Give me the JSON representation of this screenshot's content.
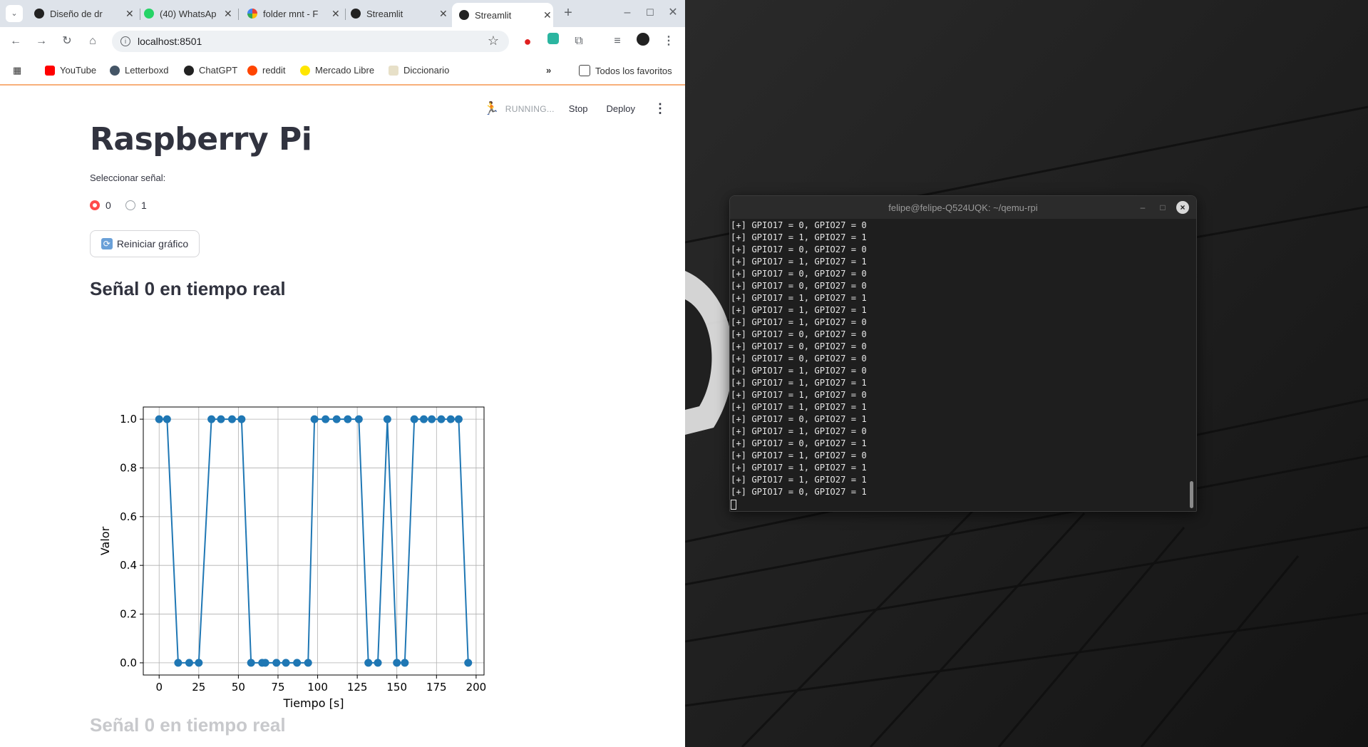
{
  "browser": {
    "tabs": [
      {
        "label": "Diseño de dr",
        "icon": "openai-icon"
      },
      {
        "label": "(40) WhatsAp",
        "icon": "whatsapp-icon"
      },
      {
        "label": "folder mnt - F",
        "icon": "google-icon"
      },
      {
        "label": "Streamlit",
        "icon": "streamlit-icon"
      },
      {
        "label": "Streamlit",
        "icon": "streamlit-icon"
      }
    ],
    "url": "localhost:8501",
    "bookmarks": [
      "YouTube",
      "Letterboxd",
      "ChatGPT",
      "reddit",
      "Mercado Libre",
      "Diccionario"
    ],
    "all_bookmarks": "Todos los favoritos"
  },
  "app": {
    "status": "RUNNING...",
    "stop": "Stop",
    "deploy": "Deploy",
    "title": "Raspberry Pi",
    "radio_label": "Seleccionar señal:",
    "radio_options": [
      "0",
      "1"
    ],
    "selected": "0",
    "reset_button": "Reiniciar gráfico",
    "subheader": "Señal 0 en tiempo real",
    "subheader_faded": "Señal 0 en tiempo real"
  },
  "chart_data": {
    "type": "line",
    "xlabel": "Tiempo [s]",
    "ylabel": "Valor",
    "xlim": [
      -10,
      205
    ],
    "ylim": [
      -0.05,
      1.05
    ],
    "xticks": [
      0,
      25,
      50,
      75,
      100,
      125,
      150,
      175,
      200
    ],
    "yticks": [
      0.0,
      0.2,
      0.4,
      0.6,
      0.8,
      1.0
    ],
    "grid": true,
    "color": "#1f77b4",
    "x": [
      0,
      5,
      12,
      19,
      25,
      33,
      39,
      46,
      52,
      58,
      65,
      67,
      74,
      80,
      87,
      94,
      98,
      105,
      112,
      119,
      126,
      132,
      138,
      144,
      150,
      155,
      161,
      167,
      172,
      178,
      184,
      189,
      195
    ],
    "y": [
      1,
      1,
      0,
      0,
      0,
      1,
      1,
      1,
      1,
      0,
      0,
      0,
      0,
      0,
      0,
      0,
      1,
      1,
      1,
      1,
      1,
      0,
      0,
      1,
      0,
      0,
      1,
      1,
      1,
      1,
      1,
      1,
      0
    ]
  },
  "terminal": {
    "title": "felipe@felipe-Q524UQK: ~/qemu-rpi",
    "lines": [
      "[+] GPIO17 = 0, GPIO27 = 0",
      "[+] GPIO17 = 1, GPIO27 = 1",
      "[+] GPIO17 = 0, GPIO27 = 0",
      "[+] GPIO17 = 1, GPIO27 = 1",
      "[+] GPIO17 = 0, GPIO27 = 0",
      "[+] GPIO17 = 0, GPIO27 = 0",
      "[+] GPIO17 = 1, GPIO27 = 1",
      "[+] GPIO17 = 1, GPIO27 = 1",
      "[+] GPIO17 = 1, GPIO27 = 0",
      "[+] GPIO17 = 0, GPIO27 = 0",
      "[+] GPIO17 = 0, GPIO27 = 0",
      "[+] GPIO17 = 0, GPIO27 = 0",
      "[+] GPIO17 = 1, GPIO27 = 0",
      "[+] GPIO17 = 1, GPIO27 = 1",
      "[+] GPIO17 = 1, GPIO27 = 0",
      "[+] GPIO17 = 1, GPIO27 = 1",
      "[+] GPIO17 = 0, GPIO27 = 1",
      "[+] GPIO17 = 1, GPIO27 = 0",
      "[+] GPIO17 = 0, GPIO27 = 1",
      "[+] GPIO17 = 1, GPIO27 = 0",
      "[+] GPIO17 = 1, GPIO27 = 1",
      "[+] GPIO17 = 1, GPIO27 = 1",
      "[+] GPIO17 = 0, GPIO27 = 1"
    ]
  }
}
